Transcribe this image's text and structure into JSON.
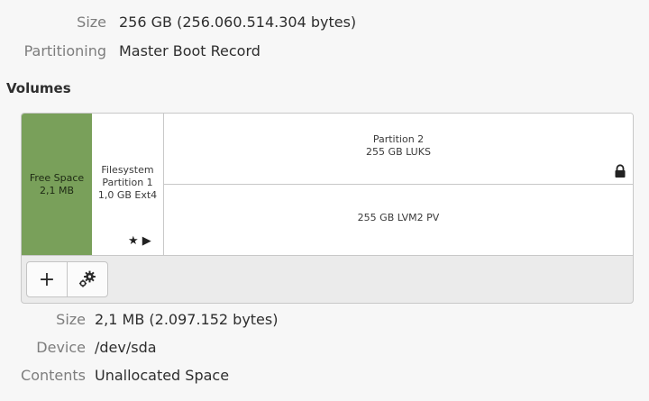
{
  "disk": {
    "size_label": "Size",
    "size_value": "256 GB (256.060.514.304 bytes)",
    "partitioning_label": "Partitioning",
    "partitioning_value": "Master Boot Record"
  },
  "volumes": {
    "heading": "Volumes",
    "segments": {
      "free_space": {
        "line1": "Free Space",
        "line2": "2,1 MB",
        "color": "#79a05a"
      },
      "partition1": {
        "line1": "Filesystem",
        "line2": "Partition 1",
        "line3": "1,0 GB Ext4",
        "glyphs": "★ ▶"
      },
      "partition2": {
        "line1": "Partition 2",
        "line2": "255 GB LUKS",
        "icon": "lock-icon"
      },
      "lvm": {
        "line1": "255 GB LVM2 PV"
      }
    },
    "toolbar": {
      "add_label": "+",
      "add_icon": "plus-icon",
      "settings_icon": "gears-icon"
    }
  },
  "selected": {
    "size_label": "Size",
    "size_value": "2,1 MB (2.097.152 bytes)",
    "device_label": "Device",
    "device_value": "/dev/sda",
    "contents_label": "Contents",
    "contents_value": "Unallocated Space"
  }
}
